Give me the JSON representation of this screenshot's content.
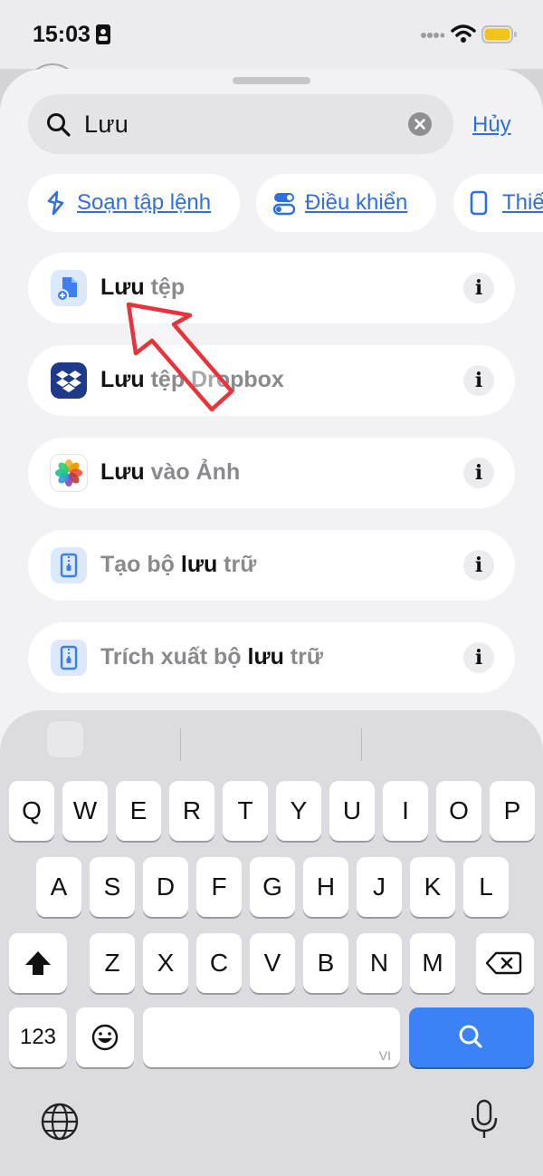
{
  "status_bar": {
    "time": "15:03"
  },
  "search": {
    "query": "Lưu",
    "cancel_label": "Hủy"
  },
  "chips": [
    {
      "label": "Soạn tập lệnh"
    },
    {
      "label": "Điều khiển"
    },
    {
      "label": "Thiế"
    }
  ],
  "results": [
    {
      "hl": "Lưu",
      "rest": " tệp",
      "icon": "files-icon"
    },
    {
      "hl": "Lưu",
      "rest": " tệp Dropbox",
      "icon": "dropbox-icon"
    },
    {
      "hl": "Lưu",
      "rest": " vào Ảnh",
      "icon": "photos-icon"
    },
    {
      "pre": "Tạo bộ ",
      "hl": "lưu",
      "rest": " trữ",
      "icon": "archive-icon"
    },
    {
      "pre": "Trích xuất bộ ",
      "hl": "lưu",
      "rest": " trữ",
      "icon": "archive-icon"
    }
  ],
  "info_glyph": "i",
  "keyboard": {
    "row1": [
      "Q",
      "W",
      "E",
      "R",
      "T",
      "Y",
      "U",
      "I",
      "O",
      "P"
    ],
    "row2": [
      "A",
      "S",
      "D",
      "F",
      "G",
      "H",
      "J",
      "K",
      "L"
    ],
    "row3": [
      "Z",
      "X",
      "C",
      "V",
      "B",
      "N",
      "M"
    ],
    "numbers_label": "123",
    "space_sublabel": "VI"
  },
  "colors": {
    "accent": "#2f6fe0",
    "search_key": "#3b82f6",
    "annotation_arrow": "#e8323c"
  }
}
